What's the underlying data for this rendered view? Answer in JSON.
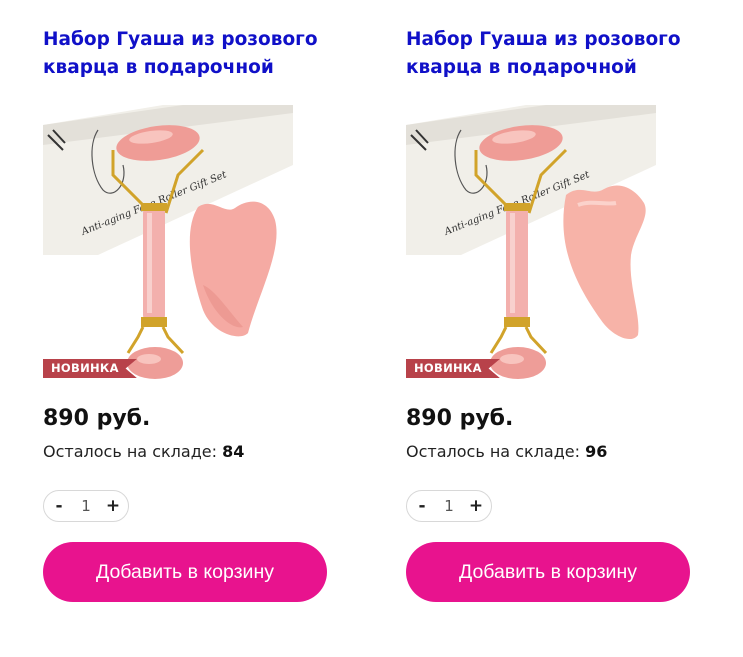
{
  "products": [
    {
      "title": "Набор Гуаша из розового кварца в подарочной",
      "badge": "НОВИНКА",
      "box_text": "Anti-aging Face Roller Gift Set",
      "price": "890 руб.",
      "stock_label": "Осталось на складе:",
      "stock_value": "84",
      "qty_minus": "-",
      "qty_value": "1",
      "qty_plus": "+",
      "cart_label": "Добавить в корзину"
    },
    {
      "title": "Набор Гуаша из розового кварца в подарочной",
      "badge": "НОВИНКА",
      "box_text": "Anti-aging Face Roller Gift Set",
      "price": "890 руб.",
      "stock_label": "Осталось на складе:",
      "stock_value": "96",
      "qty_minus": "-",
      "qty_value": "1",
      "qty_plus": "+",
      "cart_label": "Добавить в корзину"
    }
  ],
  "colors": {
    "title": "#1010c8",
    "cart_button": "#e8138e",
    "badge": "#b8424a",
    "quartz": "#f4a9a3"
  }
}
